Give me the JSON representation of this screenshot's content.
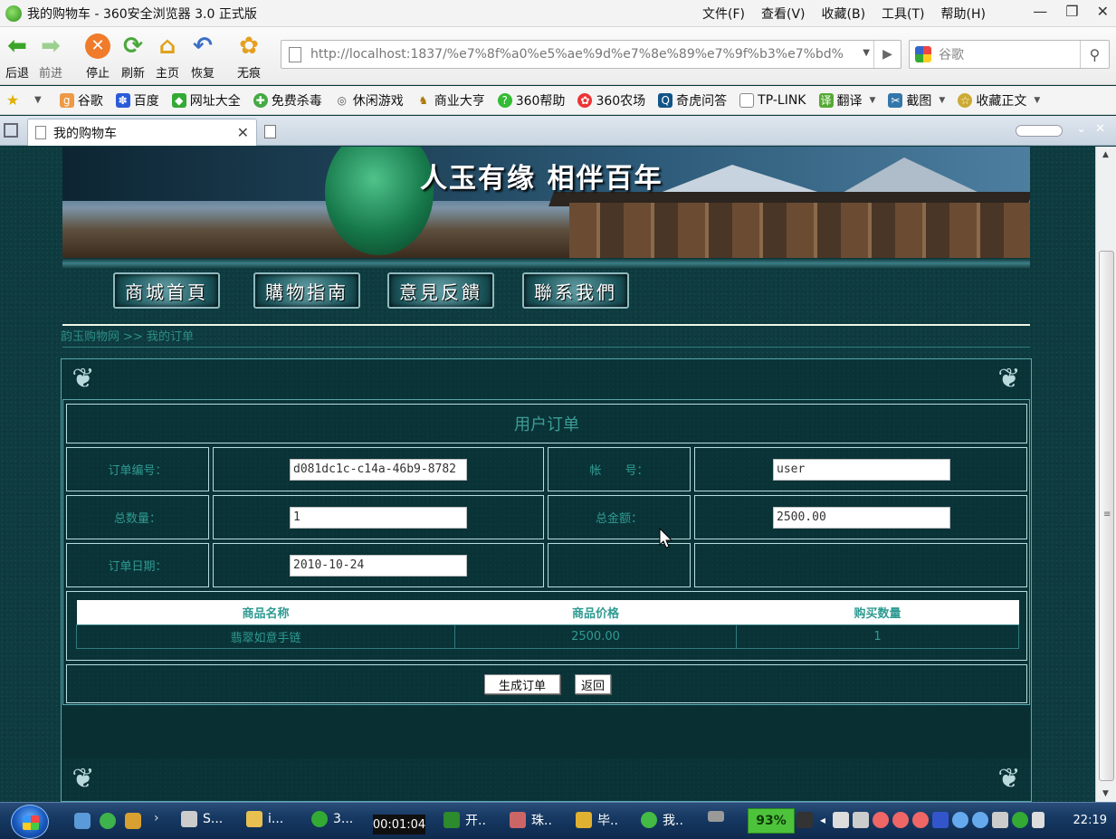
{
  "window": {
    "title": "我的购物车 - 360安全浏览器 3.0 正式版",
    "menu": [
      "文件(F)",
      "查看(V)",
      "收藏(B)",
      "工具(T)",
      "帮助(H)"
    ],
    "controls": {
      "minimize": "—",
      "restore": "❐",
      "close": "✕"
    }
  },
  "toolbar": {
    "back": "后退",
    "forward": "前进",
    "stop": "停止",
    "refresh": "刷新",
    "home": "主页",
    "restore": "恢复",
    "incognito": "无痕",
    "address": "http://localhost:1837/%e7%8f%a0%e5%ae%9d%e7%8e%89%e7%9f%b3%e7%bd%",
    "search_placeholder": "谷歌"
  },
  "bookmarks": [
    "谷歌",
    "百度",
    "网址大全",
    "免费杀毒",
    "休闲游戏",
    "商业大亨",
    "360帮助",
    "360农场",
    "奇虎问答",
    "TP-LINK",
    "翻译",
    "截图",
    "收藏正文"
  ],
  "tab": {
    "title": "我的购物车"
  },
  "banner": {
    "slogan": "人玉有缘 相伴百年"
  },
  "nav": [
    "商城首頁",
    "購物指南",
    "意見反饋",
    "聯系我們"
  ],
  "breadcrumb": "韵玉购物网 >> 我的订单",
  "order": {
    "title": "用户订单",
    "order_no_label": "订单编号：",
    "order_no": "d081dc1c-c14a-46b9-8782",
    "account_label": "帐　　号：",
    "account": "user",
    "qty_label": "总数量：",
    "qty": "1",
    "amount_label": "总金额：",
    "amount": "2500.00",
    "date_label": "订单日期：",
    "date": "2010-10-24",
    "columns": [
      "商品名称",
      "商品价格",
      "购买数量"
    ],
    "rows": [
      [
        "翡翠如意手链",
        "2500.00",
        "1"
      ]
    ],
    "submit_label": "生成订单",
    "back_label": "返回"
  },
  "taskbar": {
    "items": [
      "S...",
      "i...",
      "3...",
      "开..",
      "珠..",
      "毕..",
      "我.."
    ],
    "timer": "00:01:04",
    "cpu": "93%",
    "clock": "22:19"
  }
}
